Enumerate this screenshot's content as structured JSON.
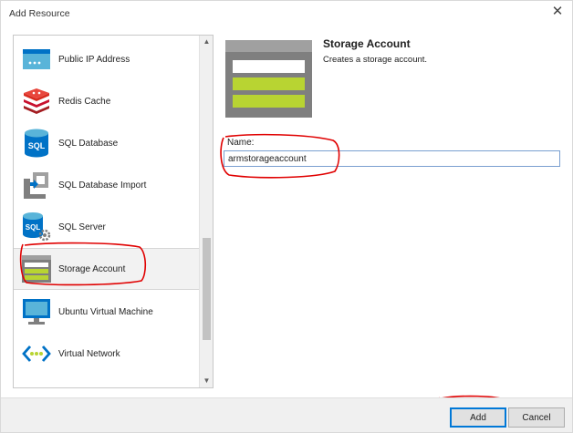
{
  "window": {
    "title": "Add Resource",
    "close_glyph": "✕"
  },
  "resource_list": {
    "items": [
      {
        "label": "Public IP Address",
        "icon": "public-ip-icon"
      },
      {
        "label": "Redis Cache",
        "icon": "redis-cache-icon"
      },
      {
        "label": "SQL Database",
        "icon": "sql-database-icon"
      },
      {
        "label": "SQL Database Import",
        "icon": "sql-database-import-icon"
      },
      {
        "label": "SQL Server",
        "icon": "sql-server-icon"
      },
      {
        "label": "Storage Account",
        "icon": "storage-account-icon",
        "selected": true
      },
      {
        "label": "Ubuntu Virtual Machine",
        "icon": "ubuntu-vm-icon"
      },
      {
        "label": "Virtual Network",
        "icon": "virtual-network-icon"
      }
    ],
    "icon_text": {
      "sql": "SQL"
    },
    "scroll_up_glyph": "▲",
    "scroll_down_glyph": "▼"
  },
  "details": {
    "name": "Storage Account",
    "description": "Creates a storage account.",
    "name_label": "Name:",
    "name_value": "armstorageaccount"
  },
  "footer": {
    "add_label": "Add",
    "cancel_label": "Cancel"
  },
  "colors": {
    "azure_blue": "#0072c6",
    "storage_green": "#b8d432",
    "storage_gray": "#7f7f7f",
    "redis_red": "#c8102e",
    "annotation_red": "#e00000",
    "selected_bg": "#f2f2f2"
  }
}
